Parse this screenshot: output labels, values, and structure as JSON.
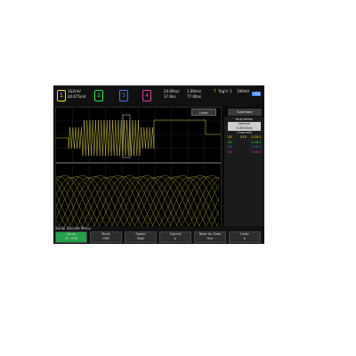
{
  "topbar": {
    "channels": [
      {
        "num": "1",
        "color": "#f2e21e"
      },
      {
        "num": "2",
        "color": "#2ee34a"
      },
      {
        "num": "3",
        "color": "#3a7bff"
      },
      {
        "num": "4",
        "color": "#e83aa8"
      }
    ],
    "readout1": "1&2mV",
    "readout2": "20.675mV",
    "timebase1": "24.00ns/",
    "timebase2": "37.9ns",
    "timebase3": "1.00ms/",
    "timebase4": "77.00ns",
    "trig1": "T",
    "trig2": "Trig'd",
    "trig3": "1",
    "trig4": "100mV",
    "brand_badge": "USB"
  },
  "lister_button": "Lister",
  "summary_button": "Summary",
  "side": {
    "acq_header": "Acquisition",
    "acq_mode": "Normal",
    "acq_rate": "5.00GSa/s",
    "ch_header": "Channels",
    "rows": [
      {
        "tag": "DC",
        "val": "533",
        "val2": "1.00:1",
        "color": "#f2e21e"
      },
      {
        "tag": "DC",
        "val": "",
        "val2": "1.00:1",
        "color": "#2ee34a"
      },
      {
        "tag": "DC",
        "val": "",
        "val2": "1.00:1",
        "color": "#3a7bff"
      },
      {
        "tag": "DC",
        "val": "",
        "val2": "1.00:1",
        "color": "#e83aa8"
      }
    ]
  },
  "menu_title": "Serial Decode Menu",
  "softkeys": [
    {
      "line1": "Serial",
      "line2": "S1: USB",
      "active": true
    },
    {
      "line1": "Mode",
      "line2": "USB",
      "active": false
    },
    {
      "line1": "Speed",
      "line2": "High",
      "active": false
    },
    {
      "line1": "Signals",
      "line2": "▸",
      "active": false
    },
    {
      "line1": "Base for Data",
      "line2": "Hex",
      "active": false
    },
    {
      "line1": "Lister",
      "line2": "▸",
      "active": false
    }
  ],
  "colors": {
    "trace": "#e6dc3a",
    "grid": "#2b2b2b"
  }
}
